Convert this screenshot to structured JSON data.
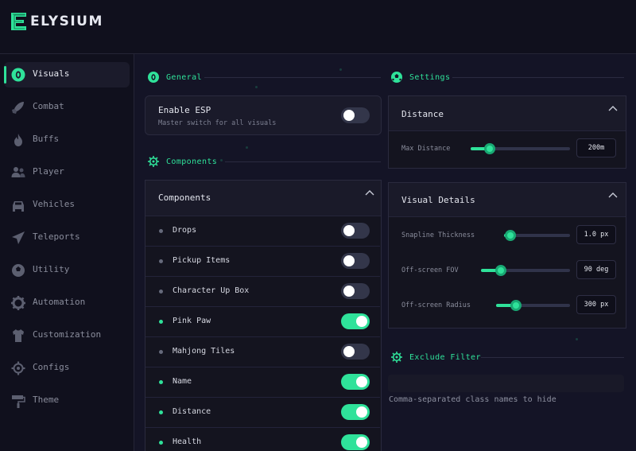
{
  "app": {
    "logo_text": "ELYSIUM",
    "accent": "#2fe29a"
  },
  "sidebar": {
    "items": [
      {
        "label": "Visuals",
        "icon": "eye-icon",
        "active": true
      },
      {
        "label": "Combat",
        "icon": "rocket-icon"
      },
      {
        "label": "Buffs",
        "icon": "flame-icon"
      },
      {
        "label": "Player",
        "icon": "users-icon"
      },
      {
        "label": "Vehicles",
        "icon": "car-icon"
      },
      {
        "label": "Teleports",
        "icon": "plane-icon"
      },
      {
        "label": "Utility",
        "icon": "globe-icon"
      },
      {
        "label": "Automation",
        "icon": "cog-icon"
      },
      {
        "label": "Customization",
        "icon": "shirt-icon"
      },
      {
        "label": "Configs",
        "icon": "gear-icon"
      },
      {
        "label": "Theme",
        "icon": "paint-roller-icon"
      }
    ]
  },
  "general": {
    "title": "General",
    "enable_esp": {
      "label": "Enable ESP",
      "description": "Master switch for all visuals",
      "on": false
    }
  },
  "components": {
    "section_title": "Components",
    "panel_title": "Components",
    "items": [
      {
        "label": "Drops",
        "on": false
      },
      {
        "label": "Pickup Items",
        "on": false
      },
      {
        "label": "Character Up Box",
        "on": false
      },
      {
        "label": "Pink Paw",
        "on": true
      },
      {
        "label": "Mahjong Tiles",
        "on": false
      },
      {
        "label": "Name",
        "on": true
      },
      {
        "label": "Distance",
        "on": true
      },
      {
        "label": "Health",
        "on": true
      }
    ]
  },
  "settings": {
    "title": "Settings",
    "distance_panel": {
      "title": "Distance",
      "max_distance": {
        "label": "Max Distance",
        "value": "200m",
        "fraction": 0.19
      }
    },
    "visual_details": {
      "title": "Visual Details",
      "snapline_thickness": {
        "label": "Snapline Thickness",
        "value": "1.0 px",
        "fraction": 0.1
      },
      "offscreen_fov": {
        "label": "Off-screen FOV",
        "value": "90 deg",
        "fraction": 0.22
      },
      "offscreen_radius": {
        "label": "Off-screen Radius",
        "value": "300 px",
        "fraction": 0.27
      }
    }
  },
  "exclude_filter": {
    "title": "Exclude Filter",
    "value": "",
    "hint": "Comma-separated class names to hide"
  }
}
